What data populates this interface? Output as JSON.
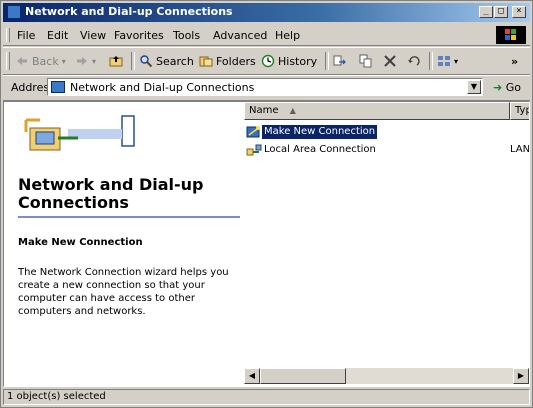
{
  "window": {
    "title": "Network and Dial-up Connections"
  },
  "title_buttons": {
    "minimize": "_",
    "maximize": "□",
    "close": "×"
  },
  "menu": [
    "File",
    "Edit",
    "View",
    "Favorites",
    "Tools",
    "Advanced",
    "Help"
  ],
  "toolbar": {
    "back": "Back",
    "search": "Search",
    "folders": "Folders",
    "history": "History",
    "more": "»"
  },
  "address": {
    "label": "Address",
    "value": "Network and Dial-up Connections",
    "go": "Go"
  },
  "left_pane": {
    "title": "Network and Dial-up Connections",
    "subheading": "Make New Connection",
    "description": "The Network Connection wizard helps you create a new connection so that your computer can have access to other computers and networks."
  },
  "list": {
    "columns": [
      "Name",
      "Typ"
    ],
    "rows": [
      {
        "name": "Make New Connection",
        "type": "",
        "selected": true,
        "icon": "wizard-icon"
      },
      {
        "name": "Local Area Connection",
        "type": "LAN",
        "selected": false,
        "icon": "lan-connection-icon"
      }
    ]
  },
  "status": {
    "text": "1 object(s) selected"
  },
  "colors": {
    "title_bar": "#0a246a",
    "selection": "#0a246a",
    "chrome": "#d4d0c8"
  }
}
